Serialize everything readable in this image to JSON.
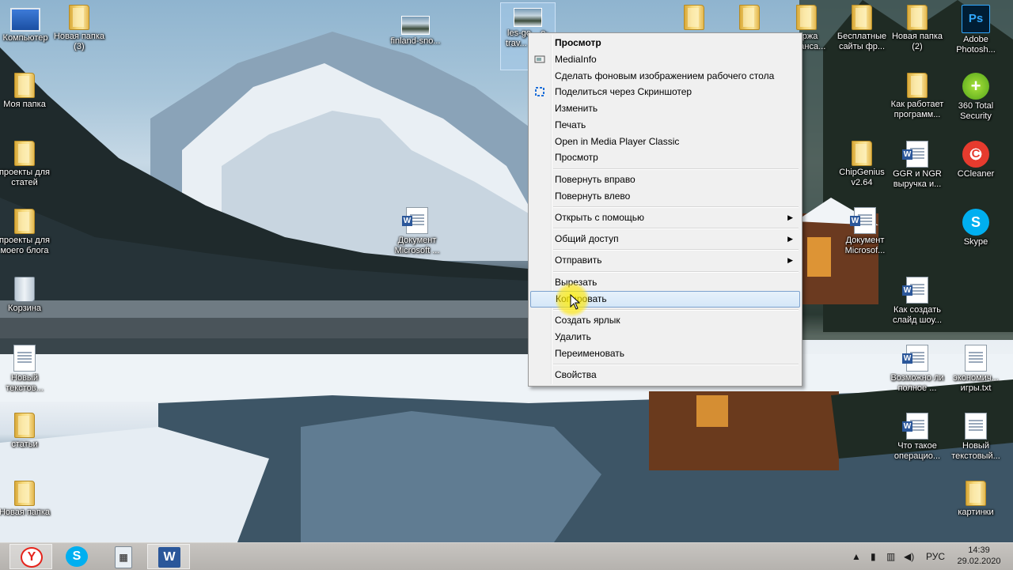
{
  "desktop_icons": {
    "computer": "Компьютер",
    "new_folder_3": "Новая папка (3)",
    "my_folder": "Моя папка",
    "projects_articles": "проекты для статей",
    "projects_blog": "проекты для моего блога",
    "recycle_bin": "Корзина",
    "new_text": "Новый текстов...",
    "articles": "статьи",
    "new_folder": "Новая папка",
    "finland_snow": "finland-sno...",
    "selected_file": "les-go... o-trav... vya...",
    "word_doc_center": "Документ Microsoft ...",
    "top_folder_1": "",
    "top_folder_2": "",
    "top_folder_3": "...ржа ...ланса...",
    "free_sites": "Бесплатные сайты фр...",
    "new_folder_2": "Новая папка (2)",
    "photoshop": "Adobe Photosh...",
    "how_programs_work": "Как работает программ...",
    "total_security": "360 Total Security",
    "chipgenius": "ChipGenius v2.64",
    "ggr_ngr": "GGR и NGR выручка и...",
    "ccleaner": "CCleaner",
    "word_doc_right": "Документ Microsof...",
    "skype": "Skype",
    "how_to_slideshow": "Как создать слайд шоу...",
    "possible_full": "Возможно ли полное ...",
    "economy_games": "экономич... игры.txt",
    "what_is_operation": "Что такое операцио...",
    "new_text_2": "Новый текстовый...",
    "pictures": "картинки"
  },
  "icons": {
    "ps": "Ps",
    "word_w": "W"
  },
  "context_menu": {
    "items": [
      {
        "label": "Просмотр",
        "bold": true
      },
      {
        "label": "MediaInfo"
      },
      {
        "label": "Сделать фоновым изображением рабочего стола"
      },
      {
        "label": "Поделиться через Скриншотер"
      },
      {
        "label": "Изменить"
      },
      {
        "label": "Печать"
      },
      {
        "label": "Open in Media Player Classic"
      },
      {
        "label": "Просмотр"
      },
      {
        "label": "Повернуть вправо"
      },
      {
        "label": "Повернуть влево"
      },
      {
        "label": "Открыть с помощью",
        "submenu": true
      },
      {
        "label": "Общий доступ",
        "submenu": true
      },
      {
        "label": "Отправить",
        "submenu": true
      },
      {
        "label": "Вырезать"
      },
      {
        "label": "Копировать",
        "highlighted": true
      },
      {
        "label": "Создать ярлык"
      },
      {
        "label": "Удалить"
      },
      {
        "label": "Переименовать"
      },
      {
        "label": "Свойства"
      }
    ],
    "submenu_arrow": "▶"
  },
  "taskbar": {
    "lang": "РУС",
    "time": "14:39",
    "date": "29.02.2020"
  },
  "colors": {
    "yandex": "#e5231b",
    "skype": "#00aff0",
    "word": "#2b579a",
    "highlight_border": "#7da2ce"
  }
}
